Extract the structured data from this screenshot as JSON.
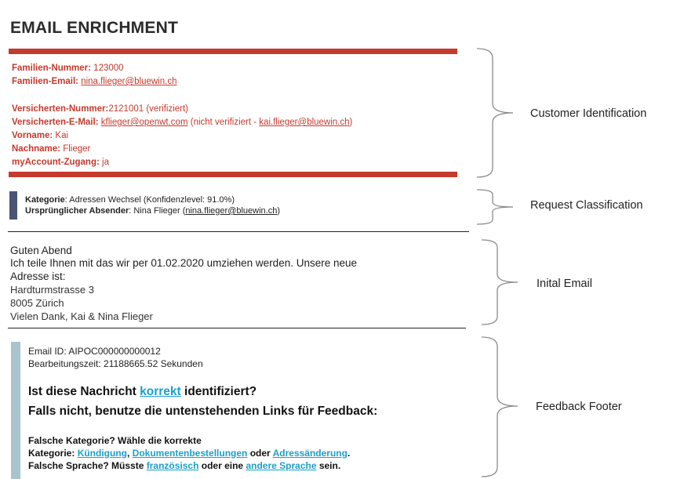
{
  "title": "EMAIL ENRICHMENT",
  "customer": {
    "familien_nummer_label": "Familien-Nummer:",
    "familien_nummer_value": "123000",
    "familien_email_label": "Familien-Email:",
    "familien_email_value": "nina.flieger@bluewin.ch",
    "versicherten_nummer_label": "Versicherten-Nummer:",
    "versicherten_nummer_value": "2121001",
    "versicherten_nummer_note": "(verifiziert)",
    "versicherten_email_label": "Versicherten-E-Mail:",
    "versicherten_email_value": "kflieger@openwt.com",
    "versicherten_email_note": "(nicht verifiziert -",
    "versicherten_email_alt": "kai.flieger@bluewin.ch",
    "versicherten_email_close": ")",
    "vorname_label": "Vorname:",
    "vorname_value": "Kai",
    "nachname_label": "Nachname:",
    "nachname_value": "Flieger",
    "myaccount_label": "myAccount-Zugang:",
    "myaccount_value": "ja"
  },
  "classification": {
    "kategorie_label": "Kategorie",
    "kategorie_value": ": Adressen Wechsel (Konfidenzlevel: 91.0%)",
    "absender_label": "Ursprünglicher Absender",
    "absender_value": ": Nina Flieger (",
    "absender_email": "nina.flieger@bluewin.ch",
    "absender_close": ")"
  },
  "email": {
    "line1": "Guten Abend",
    "line2": "Ich teile Ihnen mit das wir per 01.02.2020 umziehen werden. Unsere neue",
    "line3": "Adresse ist:",
    "line4": "Hardturmstrasse 3",
    "line5": "8005 Zürich",
    "line6": "Vielen Dank, Kai & Nina Flieger"
  },
  "feedback": {
    "email_id": "Email ID:  AIPOC000000000012",
    "bearbeitungszeit": "Bearbeitungszeit:  21188665.52  Sekunden",
    "q1_pre": "Ist diese Nachricht ",
    "q1_link": "korrekt",
    "q1_post": " identifiziert?",
    "q2": "Falls nicht, benutze die untenstehenden Links für Feedback:",
    "l1": "Falsche Kategorie? Wähle die korrekte",
    "l2_pre": "Kategorie: ",
    "l2_link1": "Kündigung",
    "l2_sep": ", ",
    "l2_link2": "Dokumentenbestellungen",
    "l2_mid": " oder ",
    "l2_link3": "Adressänderung",
    "l2_end": ".",
    "l3_pre": "Falsche Sprache? Müsste  ",
    "l3_link1": "französisch",
    "l3_mid": "  oder eine ",
    "l3_link2": "andere Sprache",
    "l3_end": " sein."
  },
  "sections": {
    "customer_identification": "Customer Identification",
    "request_classification": "Request Classification",
    "initial_email": "Inital Email",
    "feedback_footer": "Feedback Footer"
  },
  "colors": {
    "accent_red": "#c43a2c",
    "classification_bar": "#4a5573",
    "feedback_bar": "#a9c4cc",
    "link_blue": "#1ba0c9"
  }
}
